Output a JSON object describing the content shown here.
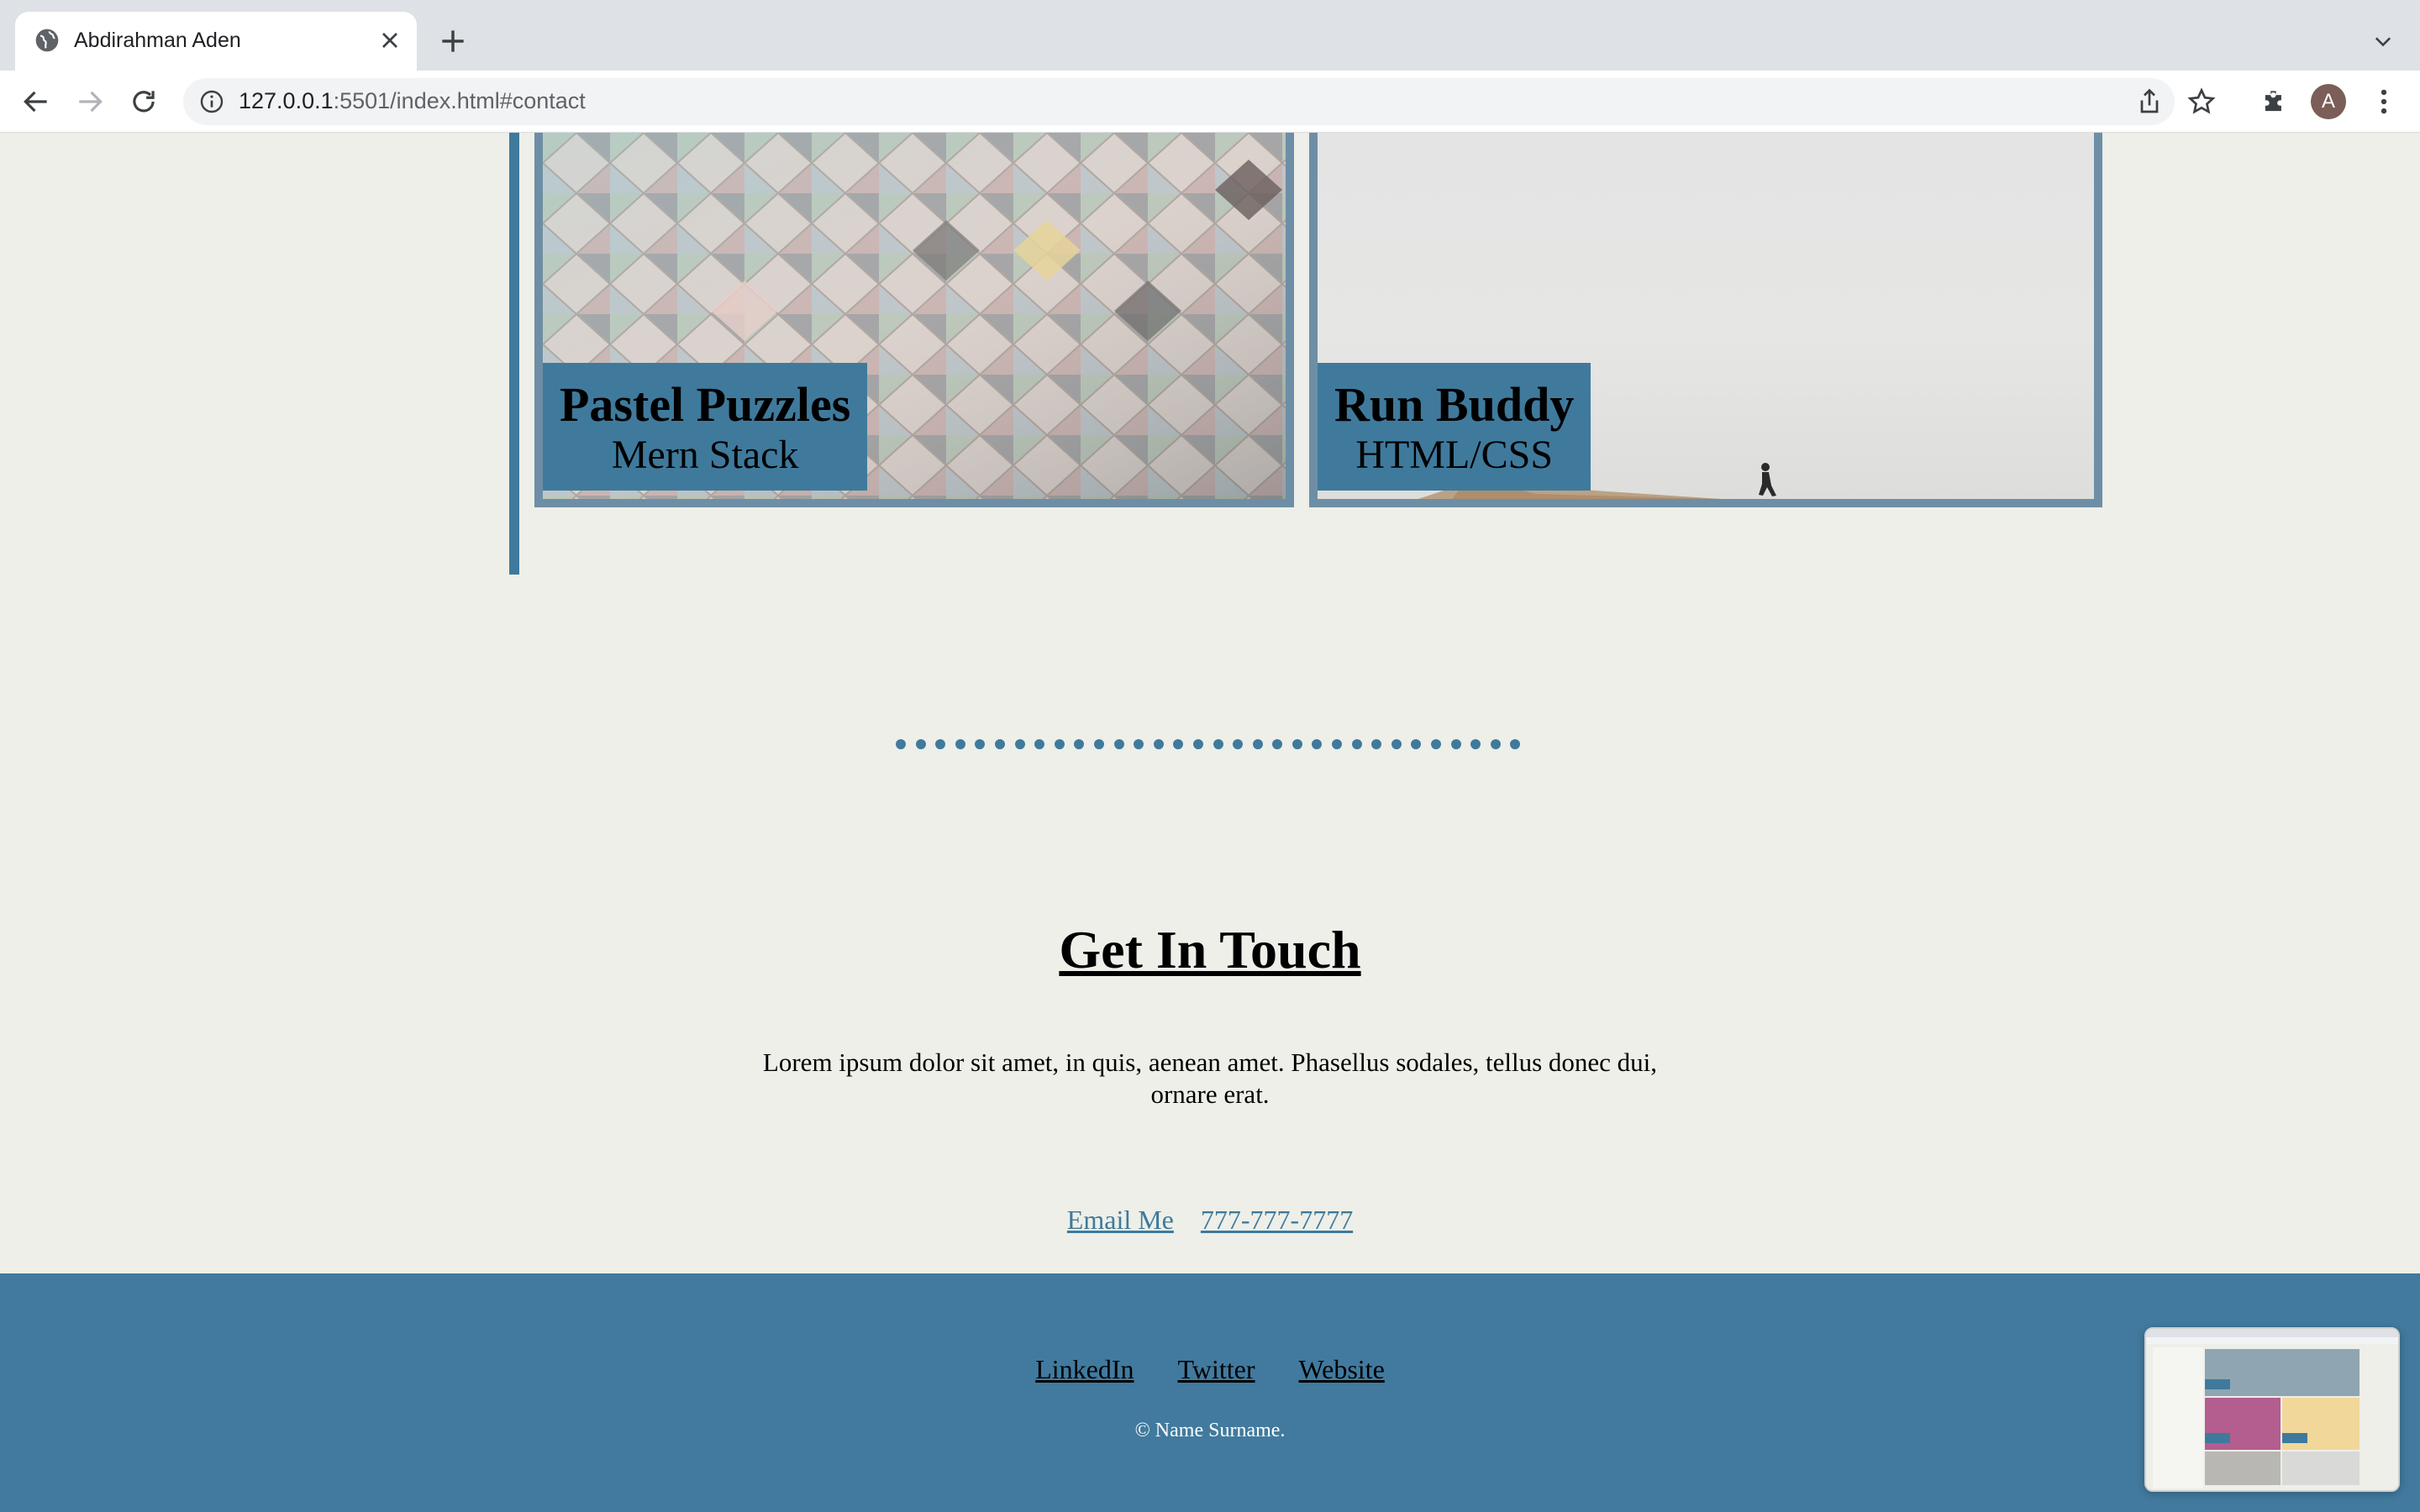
{
  "browser": {
    "tab_title": "Abdirahman Aden",
    "url_host": "127.0.0.1",
    "url_rest": ":5501/index.html#contact",
    "avatar_letter": "A"
  },
  "projects": [
    {
      "name": "Pastel Puzzles",
      "stack": "Mern Stack"
    },
    {
      "name": "Run Buddy",
      "stack": "HTML/CSS"
    }
  ],
  "contact": {
    "title": "Get In Touch",
    "text": "Lorem ipsum dolor sit amet, in quis, aenean amet. Phasellus sodales, tellus donec dui, ornare erat.",
    "email_label": "Email Me",
    "phone_label": "777-777-7777"
  },
  "footer": {
    "links": [
      "LinkedIn",
      "Twitter",
      "Website"
    ],
    "copyright": "© Name Surname."
  },
  "colors": {
    "accent": "#3f7a9c",
    "background": "#edefe8",
    "footer": "#417a9e"
  },
  "icons": [
    "globe-icon",
    "close-icon",
    "plus-icon",
    "chevron-down-icon",
    "back-arrow-icon",
    "forward-arrow-icon",
    "reload-icon",
    "info-icon",
    "share-icon",
    "star-icon",
    "puzzle-icon",
    "kebab-menu-icon"
  ]
}
